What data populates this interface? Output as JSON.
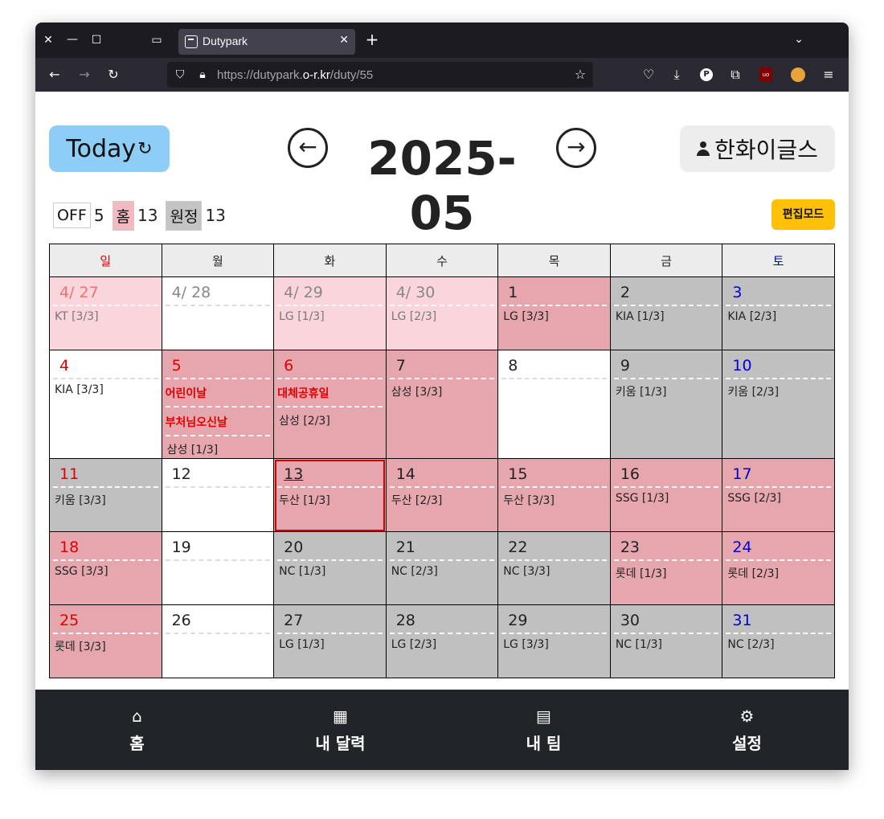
{
  "browser": {
    "tab_title": "Dutypark",
    "url_prefix": "https://dutypark.",
    "url_host": "o-r.kr",
    "url_path": "/duty/55"
  },
  "header": {
    "today_label": "Today",
    "today_icon": "↻",
    "prev_icon": "←",
    "next_icon": "→",
    "month_title": "2025-05",
    "team_name": "한화이글스"
  },
  "legend": {
    "off_label": "OFF",
    "off_count": "5",
    "home_label": "홈",
    "home_count": "13",
    "away_label": "원정",
    "away_count": "13"
  },
  "edit_mode_label": "편집모드",
  "weekdays": [
    "일",
    "월",
    "화",
    "수",
    "목",
    "금",
    "토"
  ],
  "colors": {
    "home": "#e6a6ae",
    "home_prev_month": "#fad6dc",
    "away": "#c0c0c0",
    "off": "#ffffff",
    "sunday": "#e00000",
    "saturday": "#0000d0",
    "edit_button": "#ffc107",
    "today_button": "#8ecdf5"
  },
  "weeks": [
    [
      {
        "day": "4/ 27",
        "game": "KT [3/3]"
      },
      {
        "day": "4/ 28",
        "game": ""
      },
      {
        "day": "4/ 29",
        "game": "LG [1/3]"
      },
      {
        "day": "4/ 30",
        "game": "LG [2/3]"
      },
      {
        "day": "1",
        "game": "LG [3/3]"
      },
      {
        "day": "2",
        "game": "KIA [1/3]"
      },
      {
        "day": "3",
        "game": "KIA [2/3]"
      }
    ],
    [
      {
        "day": "4",
        "game": "KIA [3/3]"
      },
      {
        "day": "5",
        "holidays": [
          "어린이날",
          "부처님오신날"
        ],
        "game": "삼성 [1/3]"
      },
      {
        "day": "6",
        "holidays": [
          "대체공휴일"
        ],
        "game": "삼성 [2/3]"
      },
      {
        "day": "7",
        "game": "삼성 [3/3]"
      },
      {
        "day": "8",
        "game": ""
      },
      {
        "day": "9",
        "game": "키움 [1/3]"
      },
      {
        "day": "10",
        "game": "키움 [2/3]"
      }
    ],
    [
      {
        "day": "11",
        "game": "키움 [3/3]"
      },
      {
        "day": "12",
        "game": ""
      },
      {
        "day": "13",
        "game": "두산 [1/3]"
      },
      {
        "day": "14",
        "game": "두산 [2/3]"
      },
      {
        "day": "15",
        "game": "두산 [3/3]"
      },
      {
        "day": "16",
        "game": "SSG [1/3]"
      },
      {
        "day": "17",
        "game": "SSG [2/3]"
      }
    ],
    [
      {
        "day": "18",
        "game": "SSG [3/3]"
      },
      {
        "day": "19",
        "game": ""
      },
      {
        "day": "20",
        "game": "NC [1/3]"
      },
      {
        "day": "21",
        "game": "NC [2/3]"
      },
      {
        "day": "22",
        "game": "NC [3/3]"
      },
      {
        "day": "23",
        "game": "롯데 [1/3]"
      },
      {
        "day": "24",
        "game": "롯데 [2/3]"
      }
    ],
    [
      {
        "day": "25",
        "game": "롯데 [3/3]"
      },
      {
        "day": "26",
        "game": ""
      },
      {
        "day": "27",
        "game": "LG [1/3]"
      },
      {
        "day": "28",
        "game": "LG [2/3]"
      },
      {
        "day": "29",
        "game": "LG [3/3]"
      },
      {
        "day": "30",
        "game": "NC [1/3]"
      },
      {
        "day": "31",
        "game": "NC [2/3]"
      }
    ]
  ],
  "bottom_nav": [
    {
      "label": "홈",
      "icon": "home-icon"
    },
    {
      "label": "내 달력",
      "icon": "calendar-icon"
    },
    {
      "label": "내 팀",
      "icon": "id-card-icon"
    },
    {
      "label": "설정",
      "icon": "gear-icon"
    }
  ]
}
